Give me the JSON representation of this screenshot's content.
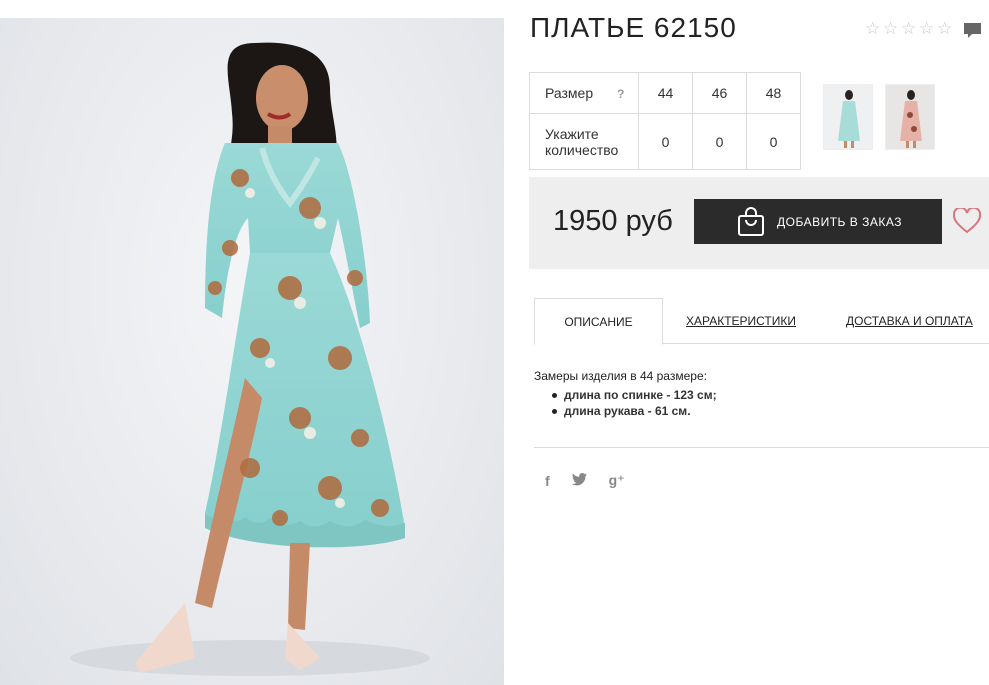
{
  "product": {
    "title": "ПЛАТЬЕ 62150",
    "rating_stars": [
      "☆",
      "☆",
      "☆",
      "☆",
      "☆"
    ]
  },
  "size_table": {
    "size_label": "Размер",
    "help_icon_text": "?",
    "sizes": [
      "44",
      "46",
      "48"
    ],
    "quantity_label_line1": "Укажите",
    "quantity_label_line2": "количество",
    "quantities": [
      "0",
      "0",
      "0"
    ]
  },
  "buy": {
    "price": "1950 руб",
    "add_button_label": "ДОБАВИТЬ В ЗАКАЗ"
  },
  "tabs": [
    {
      "label": "ОПИСАНИЕ",
      "active": true
    },
    {
      "label": "ХАРАКТЕРИСТИКИ",
      "active": false
    },
    {
      "label": "ДОСТАВКА И ОПЛАТА",
      "active": false
    }
  ],
  "description": {
    "intro": "Замеры изделия в 44 размере:",
    "items": [
      "длина по спинке - 123 см;",
      "длина рукава - 61 см."
    ]
  },
  "social": {
    "facebook": "f",
    "twitter": "🐦",
    "google_plus": "g⁺"
  },
  "colors": {
    "dark_button": "#2b2b2b",
    "panel_bg": "#eeeeee",
    "heart": "#d9737c",
    "dress_primary": "#8fd6d4"
  }
}
